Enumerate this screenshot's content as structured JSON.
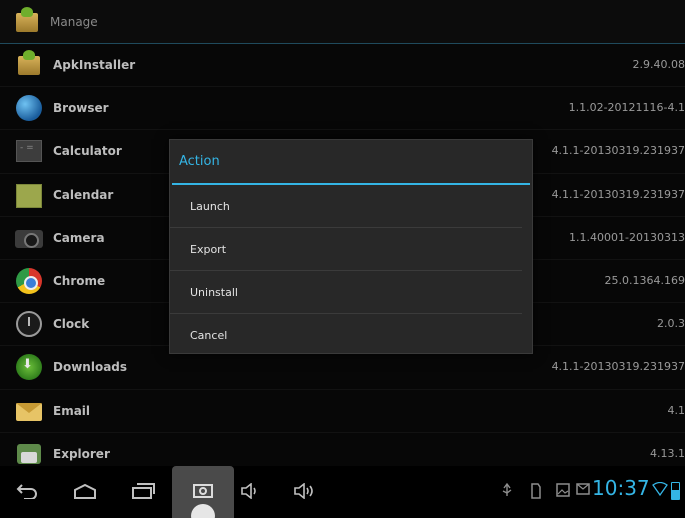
{
  "actionbar": {
    "title": "Manage",
    "icon": "package-icon"
  },
  "apps": [
    {
      "name": "ApkInstaller",
      "version": "2.9.40.08",
      "icon": "package-icon"
    },
    {
      "name": "Browser",
      "version": "1.1.02-20121116-4.1",
      "icon": "globe-icon"
    },
    {
      "name": "Calculator",
      "version": "4.1.1-20130319.231937",
      "icon": "calculator-icon"
    },
    {
      "name": "Calendar",
      "version": "4.1.1-20130319.231937",
      "icon": "calendar-icon"
    },
    {
      "name": "Camera",
      "version": "1.1.40001-20130313",
      "icon": "camera-icon"
    },
    {
      "name": "Chrome",
      "version": "25.0.1364.169",
      "icon": "chrome-icon"
    },
    {
      "name": "Clock",
      "version": "2.0.3",
      "icon": "clock-icon"
    },
    {
      "name": "Downloads",
      "version": "4.1.1-20130319.231937",
      "icon": "download-icon"
    },
    {
      "name": "Email",
      "version": "4.1",
      "icon": "email-icon"
    },
    {
      "name": "Explorer",
      "version": "4.13.1",
      "icon": "explorer-icon"
    }
  ],
  "dialog": {
    "title": "Action",
    "items": [
      "Launch",
      "Export",
      "Uninstall",
      "Cancel"
    ]
  },
  "navbar": {
    "buttons": [
      "back-icon",
      "home-icon",
      "recent-apps-icon",
      "screenshot-icon",
      "volume-down-icon",
      "volume-up-icon"
    ],
    "status_icons": [
      "usb-icon",
      "sd-card-icon",
      "image-notification-icon",
      "mail-notification-icon"
    ],
    "time": "10:37",
    "accent_color": "#34b5e5"
  }
}
